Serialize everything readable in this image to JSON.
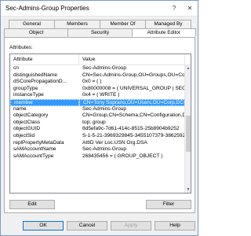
{
  "window": {
    "title": "Sec-Admins-Group Properties",
    "help": "?",
    "close": "✕"
  },
  "tabs": {
    "back_row": [
      "General",
      "Members",
      "Member Of",
      "Managed By"
    ],
    "front_row": [
      "Object",
      "Security",
      "Attribute Editor"
    ],
    "active": "Attribute Editor"
  },
  "attributes_label": "Attributes:",
  "columns": [
    "Attribute",
    "Value"
  ],
  "rows": [
    {
      "attr": "cn",
      "value": "Sec-Admins-Group"
    },
    {
      "attr": "distinguishedName",
      "value": "CN=Sec-Admins-Group,OU=Groups,OU=Corp,D"
    },
    {
      "attr": "dSCorePropagationD...",
      "value": "0x0 = ( )"
    },
    {
      "attr": "groupType",
      "value": "0x80000008 = ( UNIVERSAL_GROUP | SECUR"
    },
    {
      "attr": "instanceType",
      "value": "0x4 = ( WRITE )"
    },
    {
      "attr": "member",
      "value": "CN=Tony Soprano,OU=Users,OU=Corp,DC=l"
    },
    {
      "attr": "name",
      "value": "Sec-Admins-Group"
    },
    {
      "attr": "objectCategory",
      "value": "CN=Group,CN=Schema,CN=Configuration,DC"
    },
    {
      "attr": "objectClass",
      "value": "top; group"
    },
    {
      "attr": "objectGUID",
      "value": "8d5efa9c-7d61-414c-8515-25b8904b9252"
    },
    {
      "attr": "objectSid",
      "value": "S-1-5-21-3969329845-3455107379-3862592"
    },
    {
      "attr": "replPropertyMetaData",
      "value": "AttID  Ver   Loc.USN          Org.DSA"
    },
    {
      "attr": "sAMAccountName",
      "value": "Sec-Admins-Group"
    },
    {
      "attr": "sAMAccountType",
      "value": "268435456 = ( GROUP_OBJECT )"
    }
  ],
  "selected_row": "member",
  "buttons": {
    "edit": "Edit",
    "filter": "Filter",
    "ok": "OK",
    "cancel": "Cancel",
    "apply": "Apply",
    "help": "Help"
  }
}
